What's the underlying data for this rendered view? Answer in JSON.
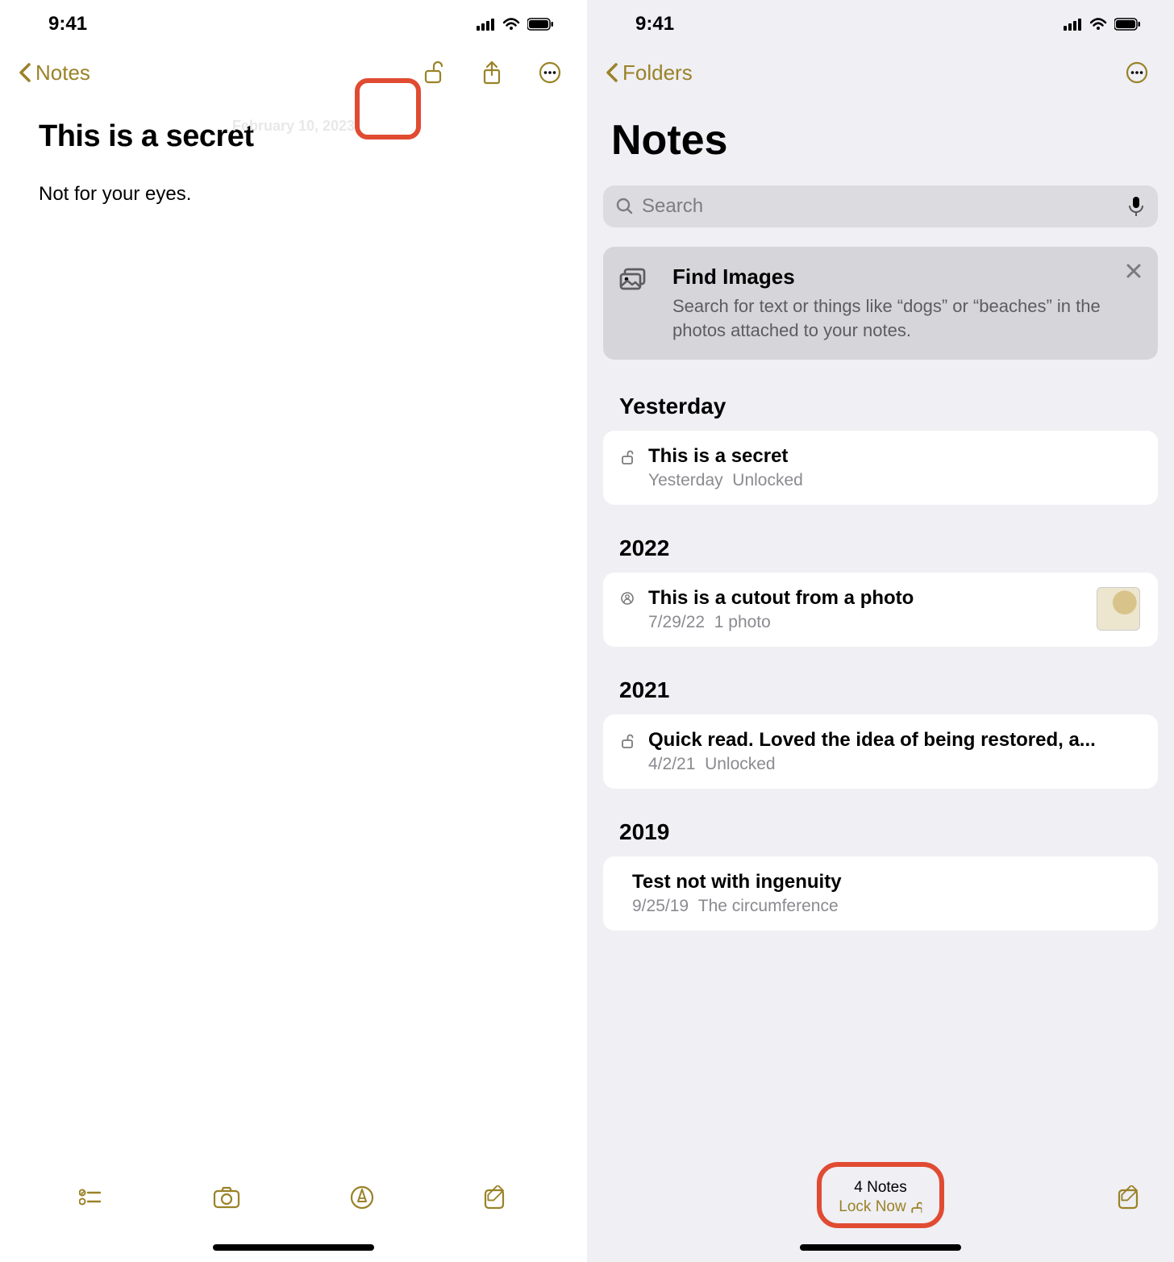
{
  "status": {
    "time": "9:41"
  },
  "left": {
    "back_label": "Notes",
    "ghost_date": "February 10, 2023",
    "note_title": "This is a secret",
    "note_body": "Not for your eyes."
  },
  "right": {
    "back_label": "Folders",
    "page_title": "Notes",
    "search_placeholder": "Search",
    "info": {
      "title": "Find Images",
      "text": "Search for text or things like “dogs” or “beaches” in the photos attached to your notes."
    },
    "sections": [
      {
        "header": "Yesterday",
        "item": {
          "title": "This is a secret",
          "date": "Yesterday",
          "status": "Unlocked",
          "icon": "lock-open"
        }
      },
      {
        "header": "2022",
        "item": {
          "title": "This is a cutout from a photo",
          "date": "7/29/22",
          "status": "1 photo",
          "icon": "attach",
          "thumb": true
        }
      },
      {
        "header": "2021",
        "item": {
          "title": "Quick read. Loved the idea of being restored, a...",
          "date": "4/2/21",
          "status": "Unlocked",
          "icon": "lock-open"
        }
      },
      {
        "header": "2019",
        "item": {
          "title": "Test not with ingenuity",
          "date": "9/25/19",
          "status": "The circumference",
          "icon": null
        }
      }
    ],
    "toolbar": {
      "count": "4 Notes",
      "lock_now": "Lock Now"
    }
  }
}
